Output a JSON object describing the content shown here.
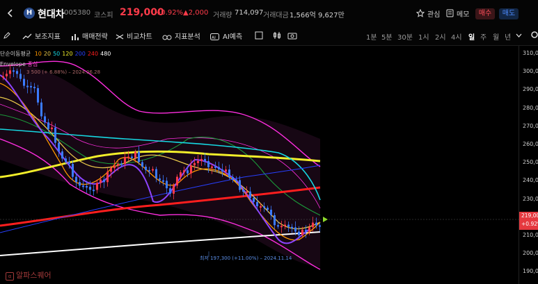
{
  "header": {
    "name": "현대차",
    "code": "005380",
    "market": "코스피",
    "price": "219,000",
    "change_pct": "+0.92%",
    "change_abs": "▲2,000",
    "volume_label": "거래량",
    "volume": "714,097",
    "amount_label": "거래대금",
    "amount": "1,566억 9,627만",
    "watch": "관심",
    "memo": "메모",
    "buy": "매수",
    "sell": "매도"
  },
  "toolbar": {
    "tools": [
      "보조지표",
      "매매전략",
      "비교차트",
      "지표분석",
      "AI예측"
    ],
    "periods": [
      "1분",
      "5분",
      "30분",
      "1시",
      "2시",
      "4시",
      "일",
      "주",
      "월",
      "년"
    ],
    "selected_period": "일"
  },
  "legend": {
    "ma_label": "단순이동평균",
    "ma_periods": [
      "10",
      "20",
      "50",
      "120",
      "200",
      "240",
      "480"
    ],
    "envelope_label": "Envelope",
    "envelope_sub": "중심",
    "high_text": "3 500 (+ 6.88%) – 2024.06.28",
    "low_text": "최저 197,300 (+11.00%) – 2024.11.14"
  },
  "colors": {
    "up": "#ff3b4a",
    "down": "#3b7bff",
    "ma10": "#ff9900",
    "ma20": "#e8c84a",
    "ma50": "#16d9e3",
    "ma120": "#f2ee2a",
    "ma200": "#2740ff",
    "ma240": "#ff1e1e",
    "ma480": "#ffffff"
  },
  "axis": {
    "ticks": [
      "310,00",
      "300,00",
      "290,00",
      "280,00",
      "270,00",
      "260,00",
      "250,00",
      "240,00",
      "230,00",
      "220,00",
      "210,00",
      "200,00",
      "190,00"
    ],
    "current_price": "219,00",
    "current_pct": "+0.92%"
  },
  "watermark": "알파스퀘어"
}
